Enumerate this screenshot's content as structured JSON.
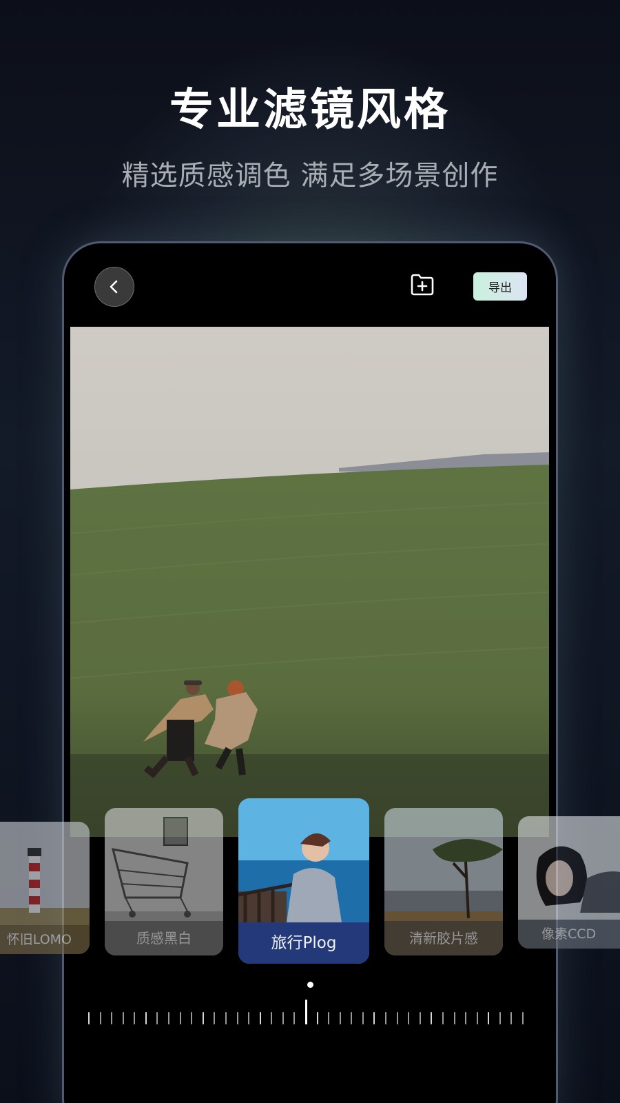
{
  "header": {
    "title": "专业滤镜风格",
    "subtitle": "精选质感调色 满足多场景创作"
  },
  "toolbar": {
    "back_icon": "chevron-left-icon",
    "add_folder_icon": "folder-plus-icon",
    "export_label": "导出"
  },
  "filters": [
    {
      "label": "怀旧LOMO",
      "selected": false
    },
    {
      "label": "质感黑白",
      "selected": false
    },
    {
      "label": "旅行Plog",
      "selected": true
    },
    {
      "label": "清新胶片感",
      "selected": false
    },
    {
      "label": "像素CCD",
      "selected": false
    }
  ],
  "slider": {
    "value": 0.5
  },
  "colors": {
    "accent_selected": "#23397a",
    "export_gradient_start": "#c9f1dd",
    "export_gradient_end": "#dce4f3"
  }
}
